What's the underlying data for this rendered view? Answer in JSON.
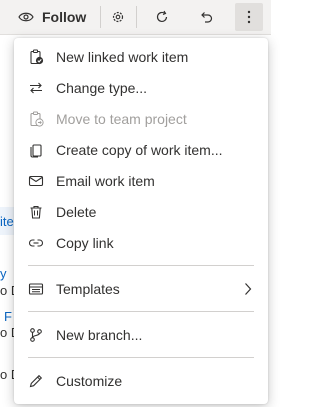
{
  "toolbar": {
    "follow_label": "Follow",
    "icons": [
      "eye-icon",
      "gear-icon",
      "refresh-icon",
      "undo-icon",
      "more-vertical-icon"
    ]
  },
  "background": {
    "fragments": [
      "ite",
      "y",
      "o D",
      "F",
      "o D",
      "o D"
    ]
  },
  "menu": {
    "items": [
      {
        "label": "New linked work item",
        "icon": "new-linked-item-icon",
        "disabled": false
      },
      {
        "label": "Change type...",
        "icon": "swap-arrows-icon",
        "disabled": false
      },
      {
        "label": "Move to team project",
        "icon": "move-project-icon",
        "disabled": true
      },
      {
        "label": "Create copy of work item...",
        "icon": "copy-icon",
        "disabled": false
      },
      {
        "label": "Email work item",
        "icon": "mail-icon",
        "disabled": false
      },
      {
        "label": "Delete",
        "icon": "trash-icon",
        "disabled": false
      },
      {
        "label": "Copy link",
        "icon": "link-icon",
        "disabled": false
      },
      {
        "label": "Templates",
        "icon": "template-icon",
        "disabled": false,
        "submenu": true
      },
      {
        "label": "New branch...",
        "icon": "branch-icon",
        "disabled": false
      },
      {
        "label": "Customize",
        "icon": "pencil-icon",
        "disabled": false
      }
    ]
  }
}
